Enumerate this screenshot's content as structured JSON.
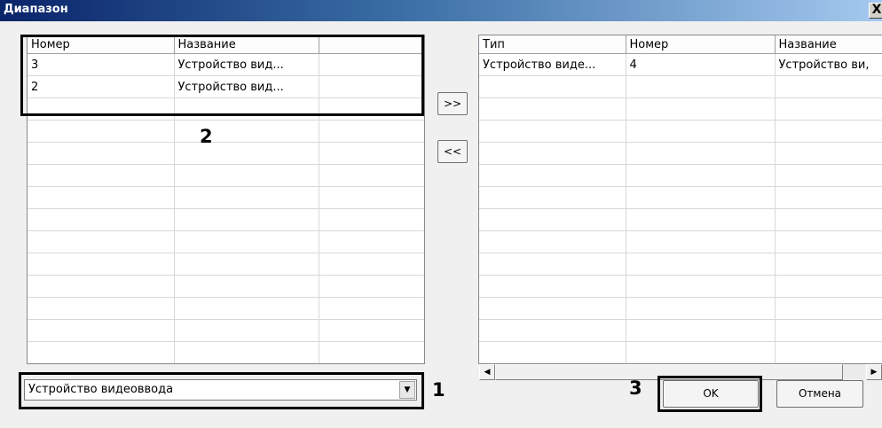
{
  "window": {
    "title": "Диапазон",
    "close_glyph": "X"
  },
  "left_table": {
    "columns": [
      "Номер",
      "Название",
      ""
    ],
    "rows": [
      [
        "3",
        "Устройство вид..."
      ],
      [
        "2",
        "Устройство вид..."
      ]
    ]
  },
  "right_table": {
    "columns": [
      "Тип",
      "Номер",
      "Название"
    ],
    "rows": [
      [
        "Устройство виде...",
        "4",
        "Устройство ви,"
      ]
    ]
  },
  "buttons": {
    "move_right": ">>",
    "move_left": "<<",
    "ok": "OK",
    "cancel": "Отмена"
  },
  "combo": {
    "value": "Устройство видеоввода"
  },
  "callouts": {
    "c1": "1",
    "c2": "2",
    "c3": "3"
  },
  "colors": {
    "titlebar": "#0a246a",
    "callout": "#000000"
  }
}
